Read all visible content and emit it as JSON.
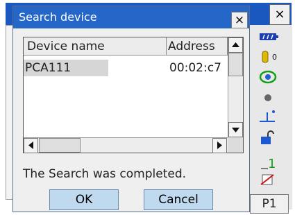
{
  "dialog": {
    "title": "Search device",
    "close_label": "×",
    "columns": [
      "Device name",
      "Address"
    ],
    "rows": [
      {
        "name": "PCA111",
        "address": "00:02:c7"
      }
    ],
    "status": "The Search was completed.",
    "ok_label": "OK",
    "cancel_label": "Cancel"
  },
  "background": {
    "close_label": "×",
    "softkey_label": "P1",
    "sidebar_icons": [
      "battery-icon",
      "tilt-icon",
      "target-icon",
      "dot-icon",
      "prism-icon",
      "lock-icon",
      "input-mode-icon",
      "memory-icon"
    ]
  },
  "colors": {
    "titlebar": "#2467c8",
    "button": "#bfd9ee",
    "selection": "#d6d6d6"
  }
}
